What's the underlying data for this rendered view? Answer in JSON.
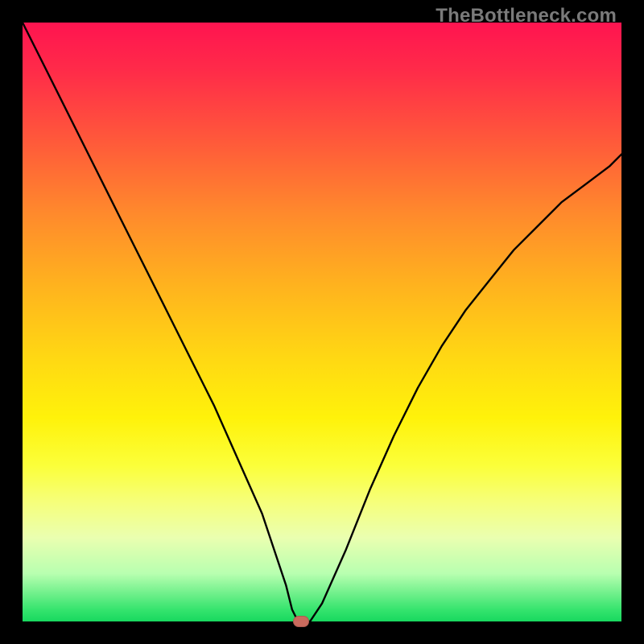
{
  "watermark": "TheBottleneck.com",
  "chart_data": {
    "type": "line",
    "title": "",
    "xlabel": "",
    "ylabel": "",
    "xlim": [
      0,
      100
    ],
    "ylim": [
      0,
      100
    ],
    "x": [
      0,
      4,
      8,
      12,
      16,
      20,
      24,
      28,
      32,
      36,
      40,
      42,
      44,
      45,
      46,
      47,
      48,
      50,
      54,
      58,
      62,
      66,
      70,
      74,
      78,
      82,
      86,
      90,
      94,
      98,
      100
    ],
    "values": [
      100,
      92,
      84,
      76,
      68,
      60,
      52,
      44,
      36,
      27,
      18,
      12,
      6,
      2,
      0,
      0,
      0,
      3,
      12,
      22,
      31,
      39,
      46,
      52,
      57,
      62,
      66,
      70,
      73,
      76,
      78
    ],
    "marker": {
      "x": 46.5,
      "y": 0
    },
    "gradient_stops": [
      {
        "pos": 0,
        "color": "#ff1450"
      },
      {
        "pos": 50,
        "color": "#ffd813"
      },
      {
        "pos": 80,
        "color": "#f6ff7a"
      },
      {
        "pos": 100,
        "color": "#18d85f"
      }
    ]
  }
}
